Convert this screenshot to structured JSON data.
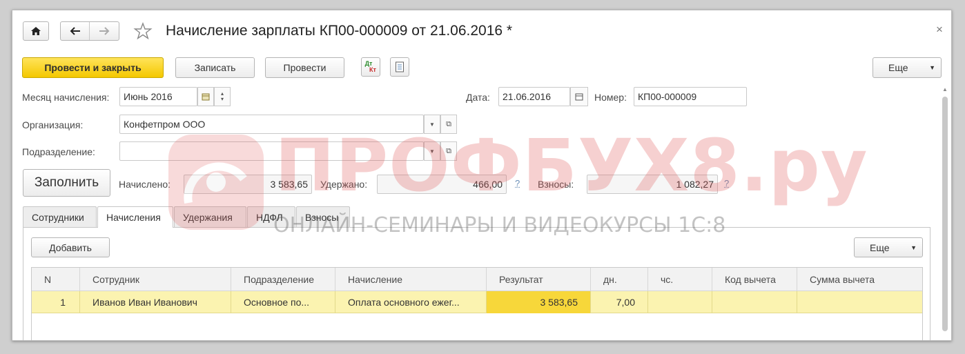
{
  "title": "Начисление зарплаты КП00-000009 от 21.06.2016 *",
  "toolbar": {
    "post_and_close": "Провести и закрыть",
    "save": "Записать",
    "post": "Провести",
    "dt_kt_top": "Дт",
    "dt_kt_bottom": "Кт",
    "more": "Еще"
  },
  "form": {
    "month_label": "Месяц начисления:",
    "month_value": "Июнь 2016",
    "date_label": "Дата:",
    "date_value": "21.06.2016",
    "number_label": "Номер:",
    "number_value": "КП00-000009",
    "org_label": "Организация:",
    "org_value": "Конфетпром ООО",
    "dept_label": "Подразделение:",
    "dept_value": ""
  },
  "summary": {
    "fill_button": "Заполнить",
    "accrued_label": "Начислено:",
    "accrued_value": "3 583,65",
    "withheld_label": "Удержано:",
    "withheld_value": "466,00",
    "contrib_label": "Взносы:",
    "contrib_value": "1 082,27",
    "help": "?"
  },
  "tabs": [
    {
      "label": "Сотрудники"
    },
    {
      "label": "Начисления"
    },
    {
      "label": "Удержания"
    },
    {
      "label": "НДФЛ"
    },
    {
      "label": "Взносы"
    }
  ],
  "table_toolbar": {
    "add": "Добавить",
    "more": "Еще"
  },
  "table": {
    "headers": [
      "N",
      "Сотрудник",
      "Подразделение",
      "Начисление",
      "Результат",
      "дн.",
      "чс.",
      "Код вычета",
      "Сумма вычета"
    ],
    "rows": [
      {
        "n": "1",
        "employee": "Иванов Иван Иванович",
        "dept": "Основное по...",
        "accrual": "Оплата основного ежег...",
        "result": "3 583,65",
        "days": "7,00",
        "hours": "",
        "code": "",
        "amount": ""
      }
    ]
  },
  "watermark": {
    "brand": "ПРОФБУХ8.ру",
    "tagline": "ОНЛАЙН-СЕМИНАРЫ И ВИДЕОКУРСЫ 1С:8"
  },
  "colors": {
    "primary": "#f4c800",
    "row_selected": "#fbf3b0",
    "result_cell": "#f7d73a",
    "watermark": "#e05a5a"
  }
}
